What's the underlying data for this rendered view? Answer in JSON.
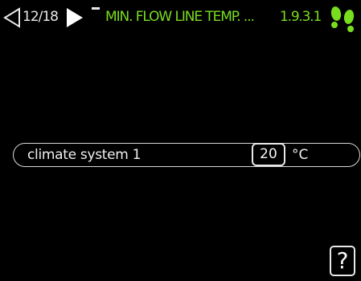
{
  "header": {
    "page_counter": "12/18",
    "menu_title": "MIN. FLOW LINE TEMP. ...",
    "menu_number": "1.9.3.1",
    "icons": {
      "back": "triangle-left-outline-icon",
      "forward": "triangle-right-filled-icon",
      "status": "footsteps-icon"
    },
    "colors": {
      "accent": "#79dd1f"
    }
  },
  "setting": {
    "label": "climate system 1",
    "value": "20",
    "unit": "°C"
  },
  "help": {
    "label": "?"
  }
}
